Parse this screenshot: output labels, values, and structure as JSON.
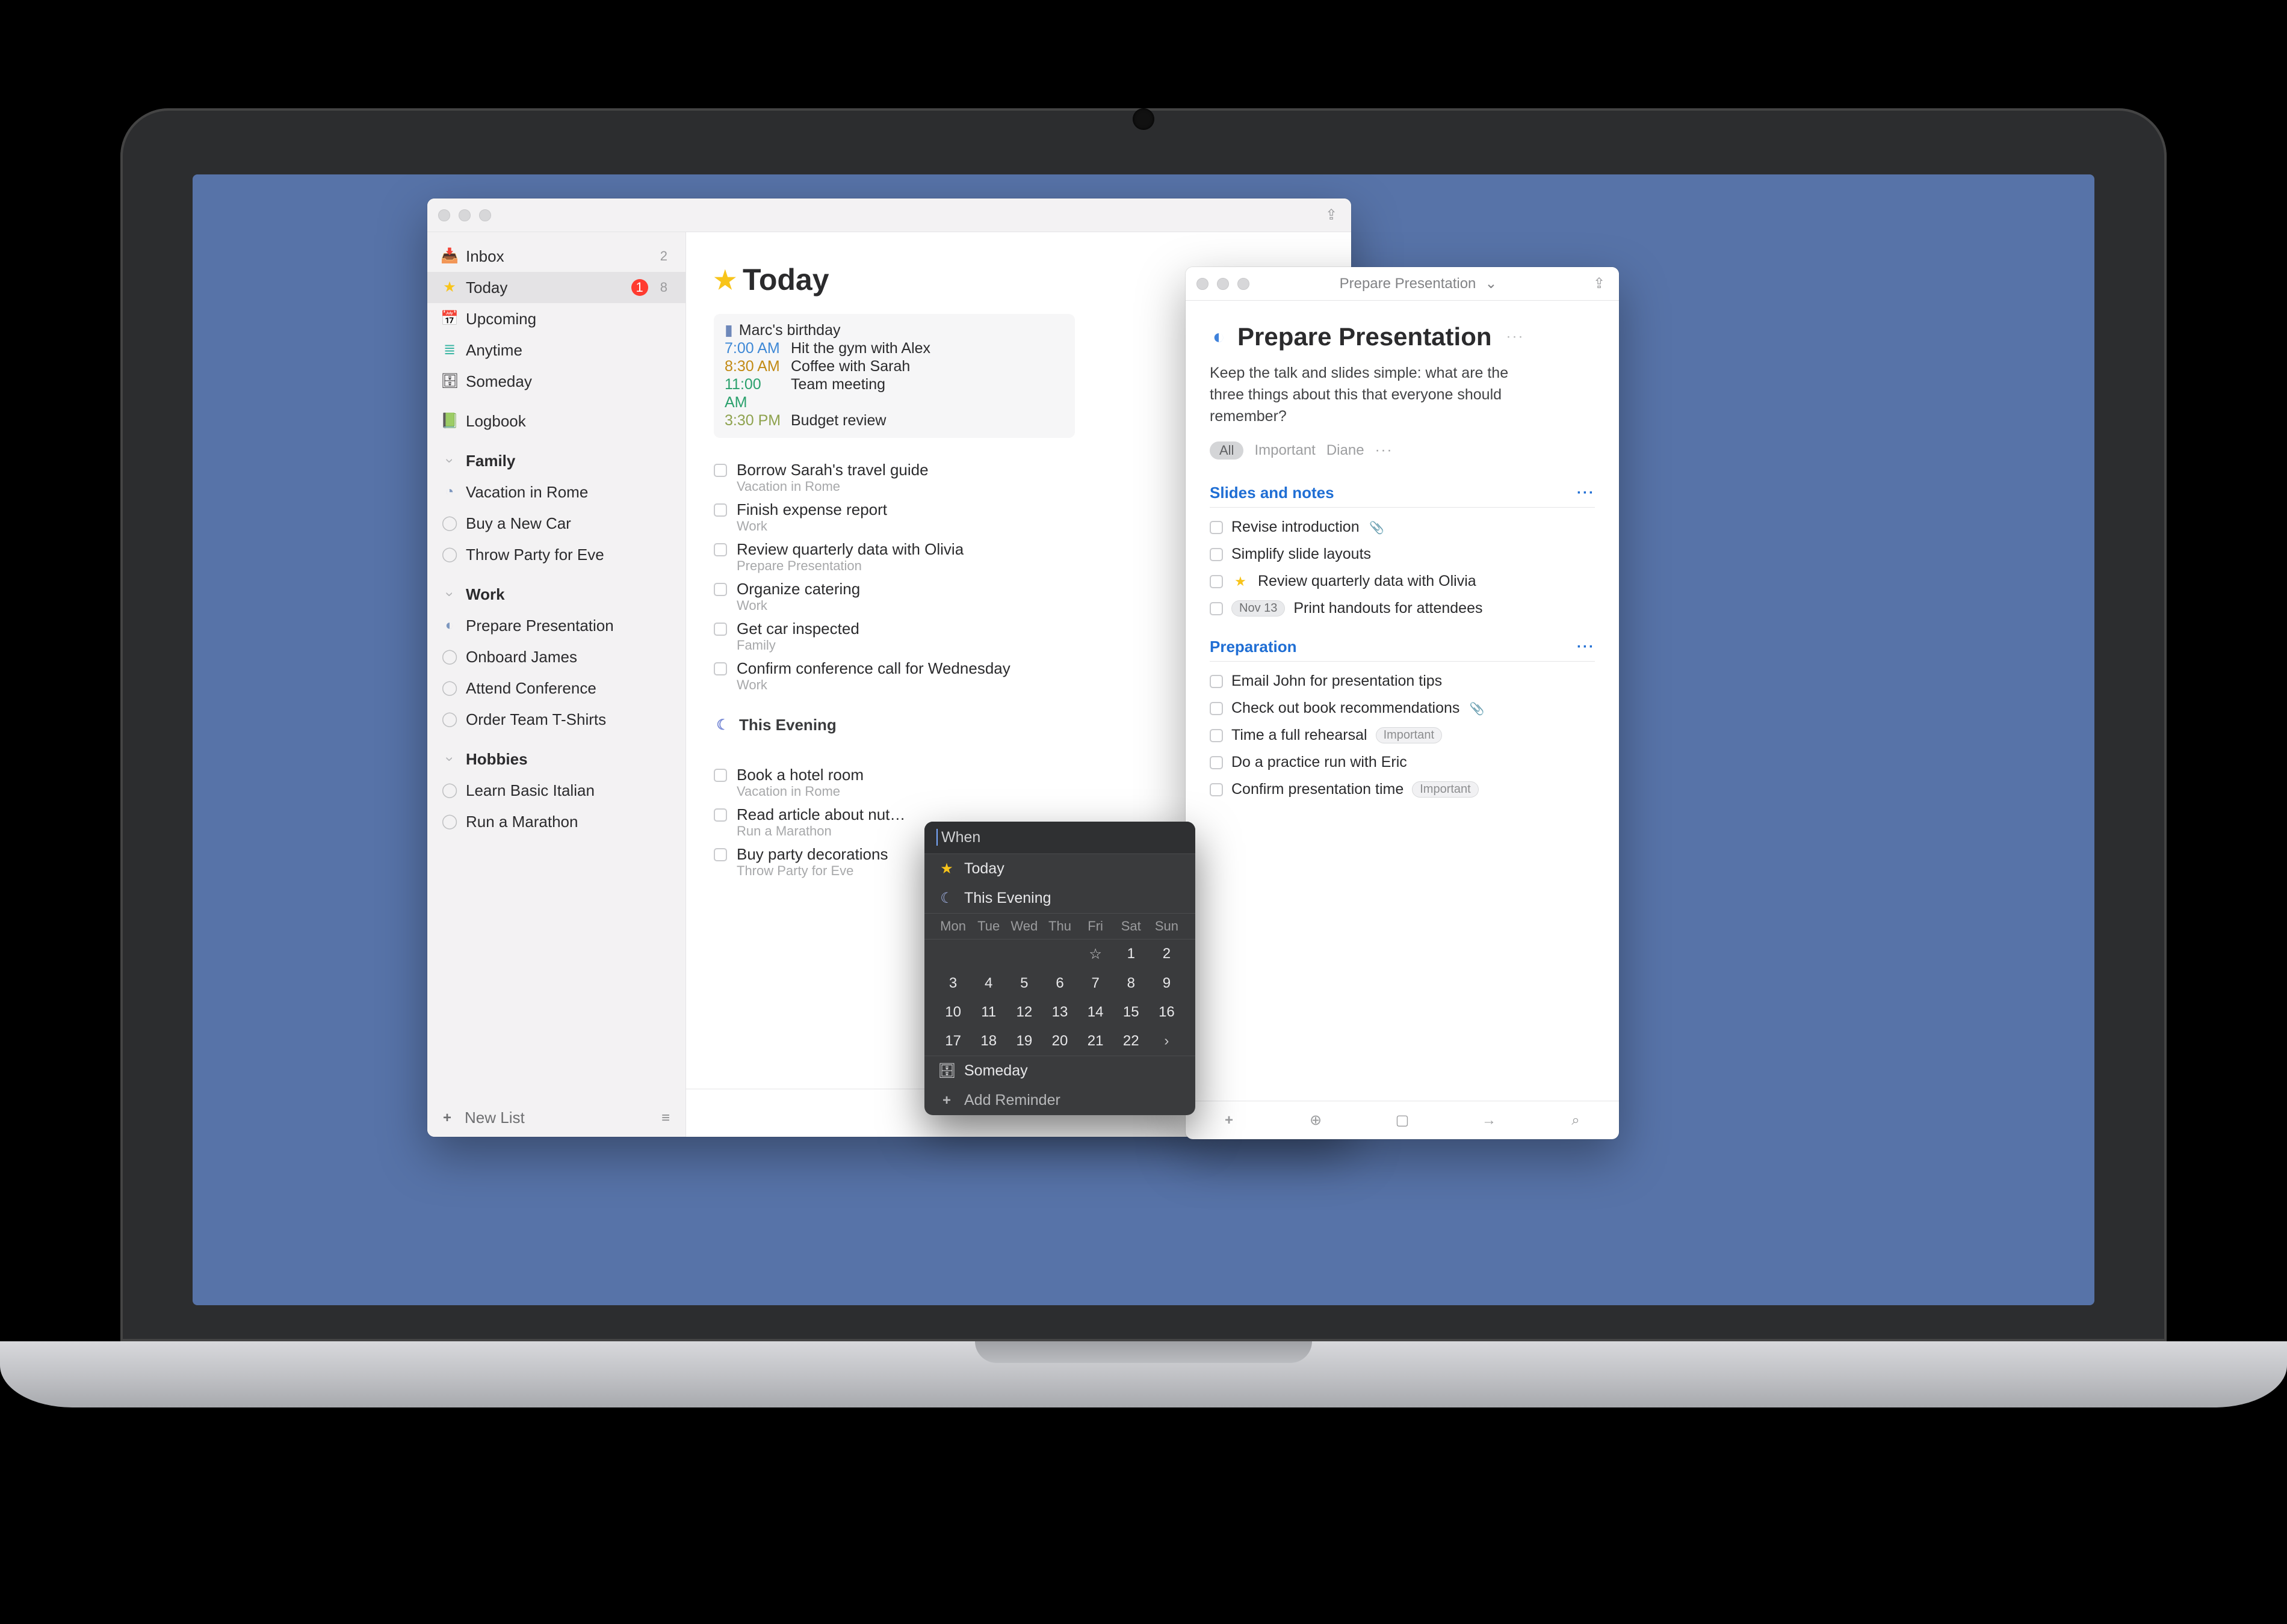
{
  "sidebar": {
    "smart": [
      {
        "id": "inbox",
        "icon": "ic-inbox",
        "label": "Inbox",
        "count": "2",
        "red_badge": false
      },
      {
        "id": "today",
        "icon": "ic-star",
        "label": "Today",
        "count": "8",
        "red_badge": true,
        "red_badge_value": "1",
        "selected": true
      },
      {
        "id": "upcoming",
        "icon": "ic-upcoming",
        "label": "Upcoming"
      },
      {
        "id": "anytime",
        "icon": "ic-anytime",
        "label": "Anytime"
      },
      {
        "id": "someday",
        "icon": "ic-someday",
        "label": "Someday"
      },
      {
        "id": "logbook",
        "icon": "ic-logbook",
        "label": "Logbook"
      }
    ],
    "areas": [
      {
        "label": "Family",
        "projects": [
          {
            "icon": "ic-pie1",
            "label": "Vacation in Rome"
          },
          {
            "icon": "ic-pie0",
            "label": "Buy a New Car"
          },
          {
            "icon": "ic-pie0",
            "label": "Throw Party for Eve"
          }
        ]
      },
      {
        "label": "Work",
        "projects": [
          {
            "icon": "ic-piehalf",
            "label": "Prepare Presentation"
          },
          {
            "icon": "ic-pie0",
            "label": "Onboard James"
          },
          {
            "icon": "ic-pie0",
            "label": "Attend Conference"
          },
          {
            "icon": "ic-pie0",
            "label": "Order Team T-Shirts"
          }
        ]
      },
      {
        "label": "Hobbies",
        "projects": [
          {
            "icon": "ic-pie0",
            "label": "Learn Basic Italian"
          },
          {
            "icon": "ic-pie0",
            "label": "Run a Marathon"
          }
        ]
      }
    ],
    "new_list_label": "New List"
  },
  "today": {
    "title": "Today",
    "agenda": [
      {
        "time": "",
        "title": "Marc's birthday",
        "cls": "allday"
      },
      {
        "time": "7:00 AM",
        "title": "Hit the gym with Alex",
        "color": "t-blue"
      },
      {
        "time": "8:30 AM",
        "title": "Coffee with Sarah",
        "color": "t-amber"
      },
      {
        "time": "11:00 AM",
        "title": "Team meeting",
        "color": "t-green"
      },
      {
        "time": "3:30 PM",
        "title": "Budget review",
        "color": "t-olive"
      }
    ],
    "tasks": [
      {
        "title": "Borrow Sarah's travel guide",
        "project": "Vacation in Rome"
      },
      {
        "title": "Finish expense report",
        "project": "Work"
      },
      {
        "title": "Review quarterly data with Olivia",
        "project": "Prepare Presentation"
      },
      {
        "title": "Organize catering",
        "project": "Work"
      },
      {
        "title": "Get car inspected",
        "project": "Family"
      },
      {
        "title": "Confirm conference call for Wednesday",
        "project": "Work"
      }
    ],
    "evening_label": "This Evening",
    "evening": [
      {
        "title": "Book a hotel room",
        "project": "Vacation in Rome"
      },
      {
        "title": "Read article about nut…",
        "project": "Run a Marathon"
      },
      {
        "title": "Buy party decorations",
        "project": "Throw Party for Eve"
      }
    ]
  },
  "project": {
    "window_title": "Prepare Presentation",
    "title": "Prepare Presentation",
    "description": "Keep the talk and slides simple: what are the three things about this that everyone should remember?",
    "chips": {
      "all": "All",
      "a": "Important",
      "b": "Diane"
    },
    "headings": {
      "h1": "Slides and notes",
      "h2": "Preparation"
    },
    "h1_tasks": [
      {
        "title": "Revise introduction",
        "note": true
      },
      {
        "title": "Simplify slide layouts"
      },
      {
        "title": "Review quarterly data with Olivia",
        "star": true
      },
      {
        "title": "Print handouts for attendees",
        "date": "Nov 13"
      }
    ],
    "h2_tasks": [
      {
        "title": "Email John for presentation tips"
      },
      {
        "title": "Check out book recommendations",
        "note": true
      },
      {
        "title": "Time a full rehearsal",
        "tag": "Important"
      },
      {
        "title": "Do a practice run with Eric"
      },
      {
        "title": "Confirm presentation time",
        "tag": "Important"
      }
    ]
  },
  "datepicker": {
    "placeholder": "When",
    "quick": {
      "today": "Today",
      "evening": "This Evening"
    },
    "dow": [
      "Mon",
      "Tue",
      "Wed",
      "Thu",
      "Fri",
      "Sat",
      "Sun"
    ],
    "row1": [
      "",
      "",
      "",
      "",
      "star",
      "1",
      "2"
    ],
    "row2": [
      "3",
      "4",
      "5",
      "6",
      "7",
      "8",
      "9"
    ],
    "row3": [
      "10",
      "11",
      "12",
      "13",
      "14",
      "15",
      "16"
    ],
    "row4": [
      "17",
      "18",
      "19",
      "20",
      "21",
      "22",
      "›"
    ],
    "someday": "Someday",
    "reminder": "Add Reminder"
  }
}
